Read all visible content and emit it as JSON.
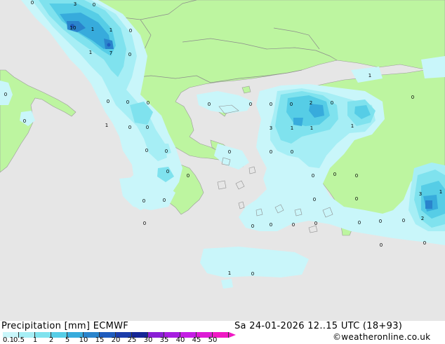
{
  "footer": {
    "title": "Precipitation [mm] ECMWF",
    "datetime": "Sa 24-01-2026 12..15 UTC (18+93)",
    "credit": "©weatheronline.co.uk"
  },
  "legend": {
    "ticks": [
      "0.1",
      "0.5",
      "1",
      "2",
      "5",
      "10",
      "15",
      "20",
      "25",
      "30",
      "35",
      "40",
      "45",
      "50"
    ],
    "colors": [
      "#c9f6fa",
      "#a6eef5",
      "#7fe2ee",
      "#56cde6",
      "#37abdc",
      "#2a84cc",
      "#1f5cbe",
      "#1b3caa",
      "#152696",
      "#8a1fd6",
      "#a61ee0",
      "#c41de4",
      "#dd1bd6",
      "#f018c4"
    ]
  },
  "colors": {
    "sea": "#e6e6e6",
    "land": "#bdf5a0",
    "border": "#8c8c8c"
  },
  "precip_labels": [
    {
      "t": "3"
    },
    {
      "t": "0"
    },
    {
      "t": "0"
    },
    {
      "t": "10"
    },
    {
      "t": "1"
    },
    {
      "t": "1"
    },
    {
      "t": "0"
    },
    {
      "t": "1"
    },
    {
      "t": "7"
    },
    {
      "t": "0"
    },
    {
      "t": "0"
    },
    {
      "t": "0"
    },
    {
      "t": "0"
    },
    {
      "t": "0"
    },
    {
      "t": "0"
    },
    {
      "t": "1"
    },
    {
      "t": "0"
    },
    {
      "t": "0"
    },
    {
      "t": "0"
    },
    {
      "t": "0"
    },
    {
      "t": "0"
    },
    {
      "t": "0"
    },
    {
      "t": "0"
    },
    {
      "t": "0"
    },
    {
      "t": "0"
    },
    {
      "t": "0"
    },
    {
      "t": "0"
    },
    {
      "t": "0"
    },
    {
      "t": "2"
    },
    {
      "t": "0"
    },
    {
      "t": "3"
    },
    {
      "t": "1"
    },
    {
      "t": "1"
    },
    {
      "t": "1"
    },
    {
      "t": "0"
    },
    {
      "t": "0"
    },
    {
      "t": "0"
    },
    {
      "t": "0"
    },
    {
      "t": "0"
    },
    {
      "t": "0"
    },
    {
      "t": "0"
    },
    {
      "t": "0"
    },
    {
      "t": "0"
    },
    {
      "t": "0"
    },
    {
      "t": "0"
    },
    {
      "t": "0"
    },
    {
      "t": "0"
    },
    {
      "t": "0"
    },
    {
      "t": "1"
    },
    {
      "t": "0"
    },
    {
      "t": "3"
    },
    {
      "t": "1"
    },
    {
      "t": "2"
    },
    {
      "t": "0"
    },
    {
      "t": "0"
    },
    {
      "t": "0"
    },
    {
      "t": "1"
    },
    {
      "t": "0"
    },
    {
      "t": "0"
    }
  ]
}
